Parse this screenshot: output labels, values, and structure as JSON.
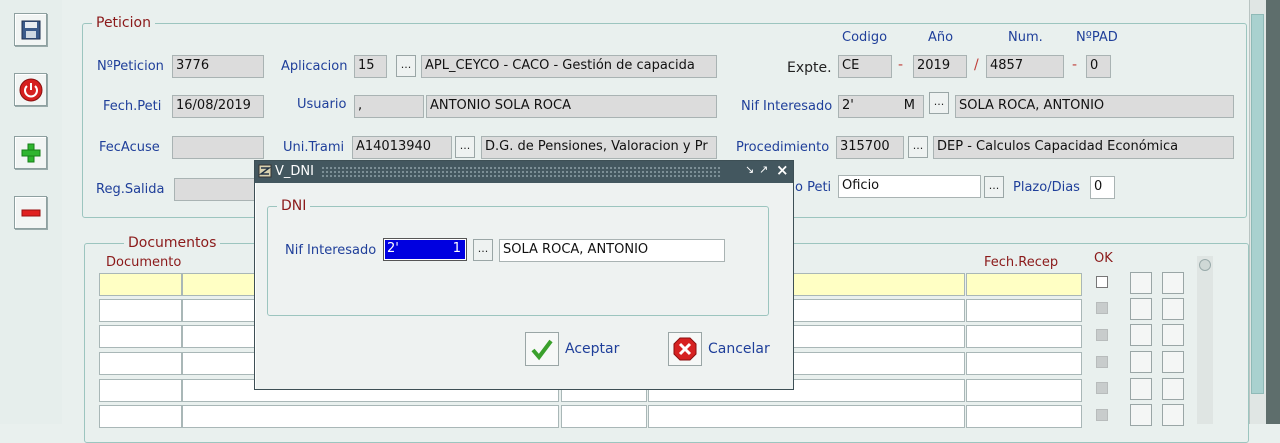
{
  "toolbar": {
    "save_icon": "floppy-save-icon",
    "exit_icon": "power-exit-icon",
    "add_icon": "green-plus-icon",
    "remove_icon": "red-minus-icon"
  },
  "peticion": {
    "frame_title": "Peticion",
    "npeticion_label": "NºPeticion",
    "npeticion_value": "3776",
    "aplicacion_label": "Aplicacion",
    "aplicacion_code": "15",
    "aplicacion_desc": "APL_CEYCO - CACO - Gestión de capacida",
    "fech_peti_label": "Fech.Peti",
    "fech_peti_value": "16/08/2019",
    "usuario_label": "Usuario",
    "usuario_code": ",",
    "usuario_name": "ANTONIO SOLA ROCA",
    "fec_acuse_label": "FecAcuse",
    "fec_acuse_value": "",
    "uni_trami_label": "Uni.Trami",
    "uni_trami_code": "A14013940",
    "uni_trami_desc": "D.G. de Pensiones, Valoracion y Pr",
    "reg_salida_label": "Reg.Salida",
    "reg_salida_value": "",
    "codigo_header": "Codigo",
    "anio_header": "Año",
    "num_header": "Num.",
    "npad_header": "NºPAD",
    "expte_label": "Expte.",
    "expte_codigo": "CE",
    "expte_sep1": "-",
    "expte_anio": "2019",
    "expte_sep2": "/",
    "expte_num": "4857",
    "expte_sep3": "-",
    "expte_npad": "0",
    "nif_interesado_label": "Nif Interesado",
    "nif_interesado_value": "2'",
    "nif_interesado_suffix": "M",
    "nif_interesado_name": "SOLA ROCA, ANTONIO",
    "procedimiento_label": "Procedimiento",
    "procedimiento_code": "315700",
    "procedimiento_desc": "DEP - Calculos Capacidad Económica",
    "tipo_peti_label": "o Peti",
    "tipo_peti_value": "Oficio",
    "plazo_label": "Plazo/Dias",
    "plazo_value": "0"
  },
  "documentos": {
    "frame_title": "Documentos",
    "col_documento": "Documento",
    "col_fech_recep": "Fech.Recep",
    "col_ok": "OK"
  },
  "lov_button": "...",
  "dialog": {
    "title": "V_DNI",
    "frame_title": "DNI",
    "nif_label": "Nif Interesado",
    "nif_value": "2'",
    "nif_value_end": "1",
    "name_value": "SOLA ROCA, ANTONIO",
    "accept_label": "Aceptar",
    "cancel_label": "Cancelar"
  }
}
